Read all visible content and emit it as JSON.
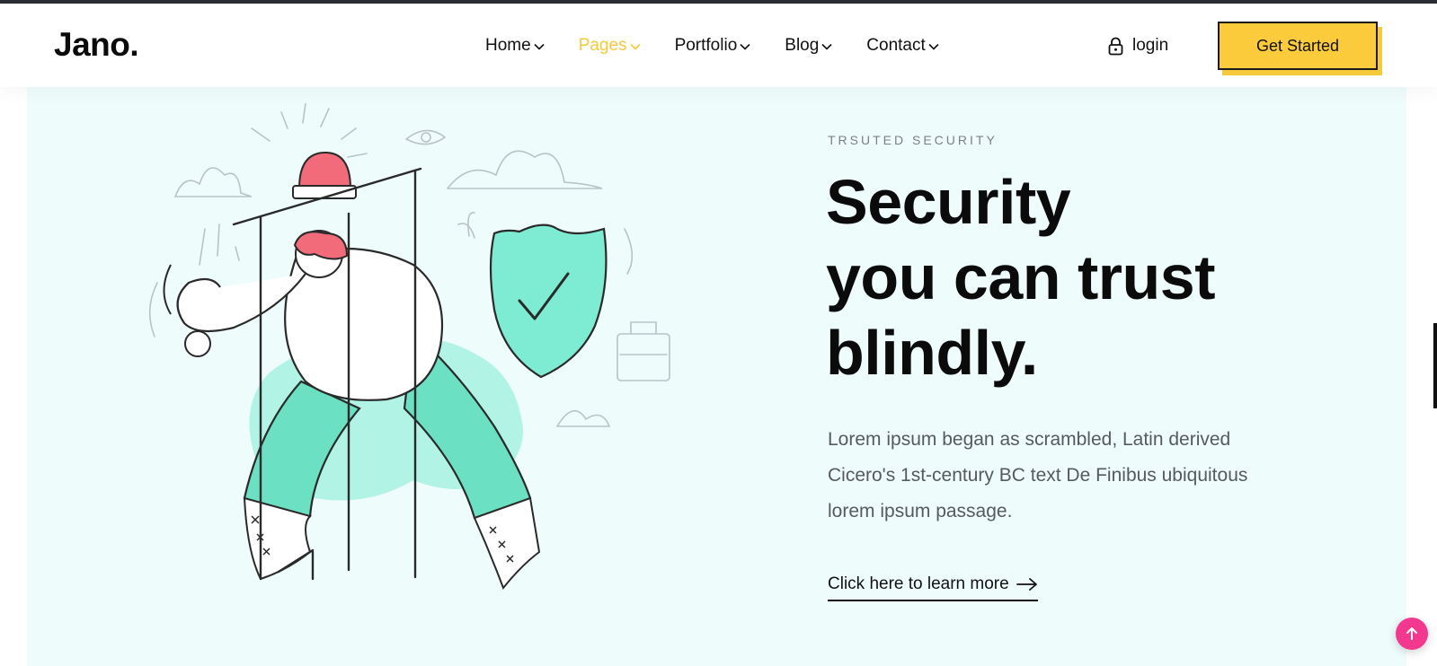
{
  "brand": {
    "logo": "Jano."
  },
  "nav": {
    "items": [
      {
        "label": "Home",
        "active": false
      },
      {
        "label": "Pages",
        "active": true
      },
      {
        "label": "Portfolio",
        "active": false
      },
      {
        "label": "Blog",
        "active": false
      },
      {
        "label": "Contact",
        "active": false
      }
    ],
    "login_label": "login",
    "cta_label": "Get Started"
  },
  "hero": {
    "eyebrow": "TRSUTED SECURITY",
    "headline_lines": [
      "Security",
      "you can trust",
      "blindly."
    ],
    "body": "Lorem ipsum began as scrambled, Latin derived Cicero's 1st-century BC text De Finibus ubiquitous lorem ipsum passage.",
    "link_label": "Click here to learn more"
  },
  "icons": {
    "nav_chevron": "chevron-down-icon",
    "login": "lock-icon",
    "link_arrow": "arrow-right-icon",
    "back_to_top": "arrow-up-icon"
  },
  "colors": {
    "accent_yellow": "#f6c93a",
    "cta_bg": "#fbcb3b",
    "hero_bg": "#effcfc",
    "mint": "#7eecd3",
    "pink": "#f2398f",
    "light_red": "#f26b7a"
  }
}
